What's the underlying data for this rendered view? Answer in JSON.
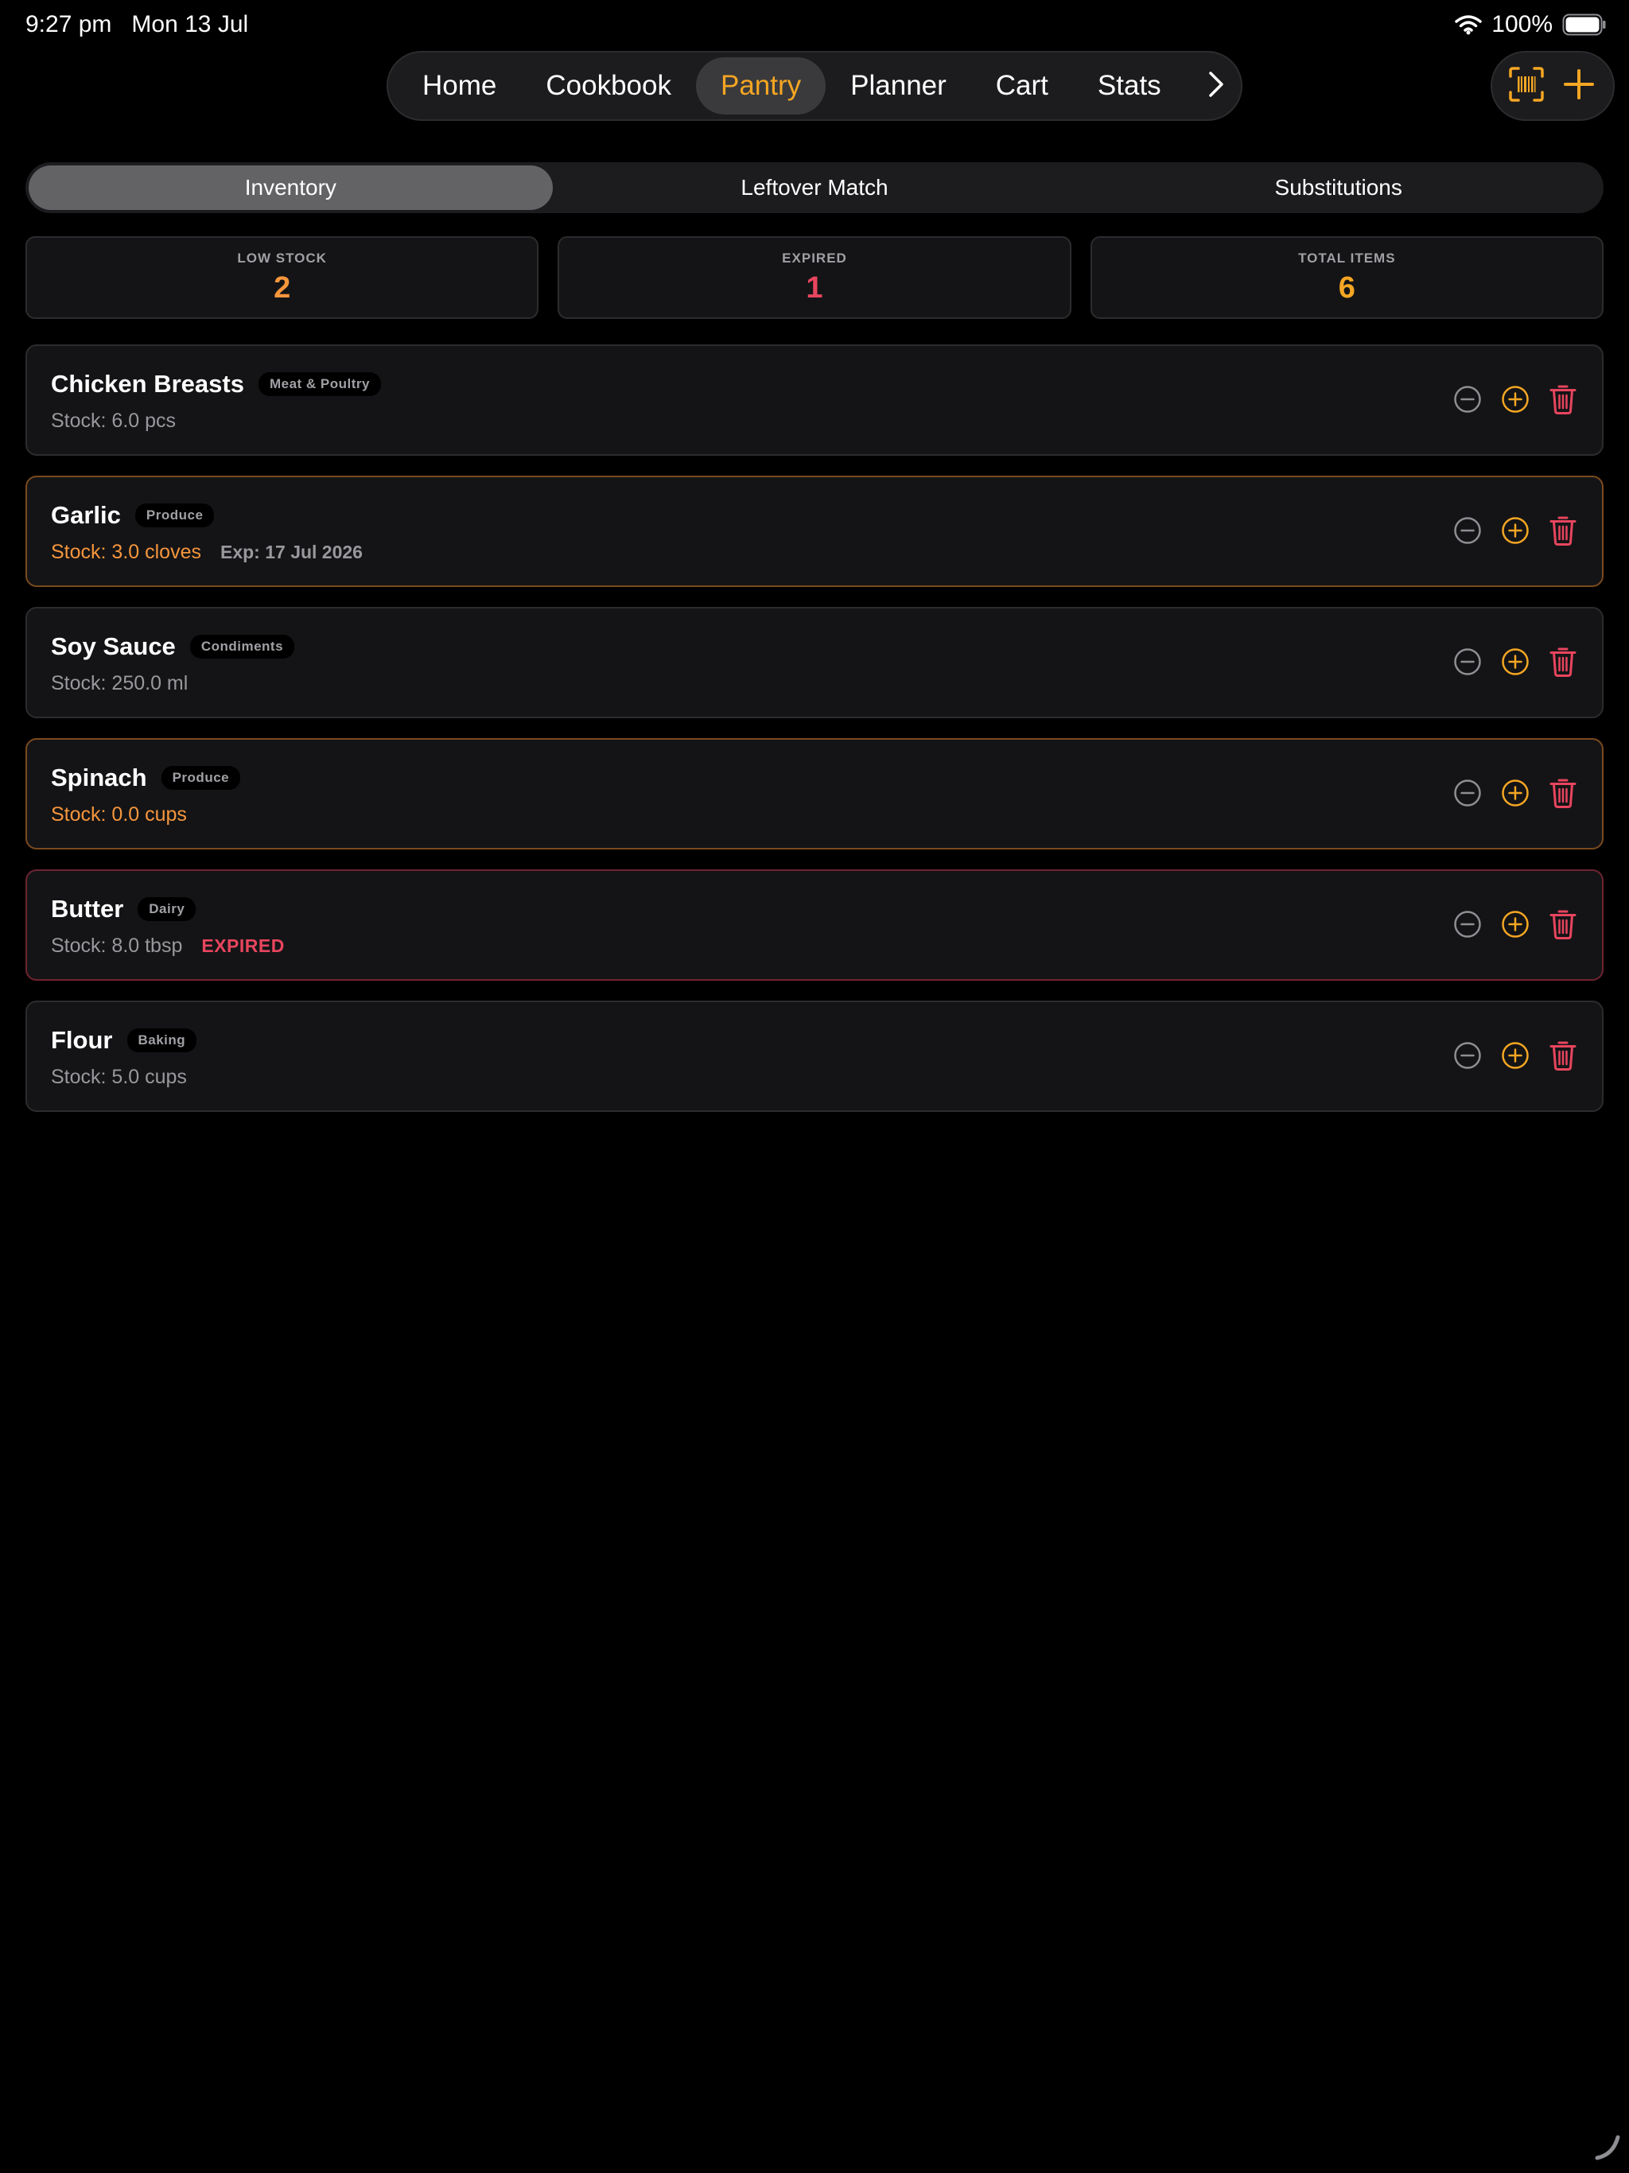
{
  "status_bar": {
    "time": "9:27 pm",
    "date": "Mon 13 Jul",
    "battery": "100%"
  },
  "nav": {
    "tabs": [
      {
        "label": "Home"
      },
      {
        "label": "Cookbook"
      },
      {
        "label": "Pantry",
        "active": true
      },
      {
        "label": "Planner"
      },
      {
        "label": "Cart"
      },
      {
        "label": "Stats"
      }
    ]
  },
  "segments": [
    {
      "label": "Inventory",
      "active": true
    },
    {
      "label": "Leftover Match"
    },
    {
      "label": "Substitutions"
    }
  ],
  "stats": {
    "low_stock": {
      "label": "LOW STOCK",
      "value": "2",
      "color": "#f5963c"
    },
    "expired": {
      "label": "EXPIRED",
      "value": "1",
      "color": "#e8455e"
    },
    "total": {
      "label": "TOTAL ITEMS",
      "value": "6",
      "color": "#f5a623"
    }
  },
  "items": [
    {
      "name": "Chicken Breasts",
      "category": "Meat & Poultry",
      "stock": "Stock: 6.0 pcs",
      "exp": "",
      "expired_label": ""
    },
    {
      "name": "Garlic",
      "category": "Produce",
      "stock": "Stock: 3.0 cloves",
      "exp": "Exp: 17 Jul 2026",
      "expired_label": ""
    },
    {
      "name": "Soy Sauce",
      "category": "Condiments",
      "stock": "Stock: 250.0 ml",
      "exp": "",
      "expired_label": ""
    },
    {
      "name": "Spinach",
      "category": "Produce",
      "stock": "Stock: 0.0 cups",
      "exp": "",
      "expired_label": ""
    },
    {
      "name": "Butter",
      "category": "Dairy",
      "stock": "Stock: 8.0 tbsp",
      "exp": "",
      "expired_label": "EXPIRED"
    },
    {
      "name": "Flour",
      "category": "Baking",
      "stock": "Stock: 5.0 cups",
      "exp": "",
      "expired_label": ""
    }
  ],
  "colors": {
    "accent": "#f5a623",
    "warning": "#f5963c",
    "danger": "#e8455e",
    "minus_icon": "#8e8e93"
  },
  "icons": {
    "nav_more": "chevron-right-icon",
    "scan": "barcode-scan-icon",
    "add": "plus-icon",
    "decrement": "minus-circle-icon",
    "increment": "plus-circle-icon",
    "delete": "trash-icon"
  }
}
